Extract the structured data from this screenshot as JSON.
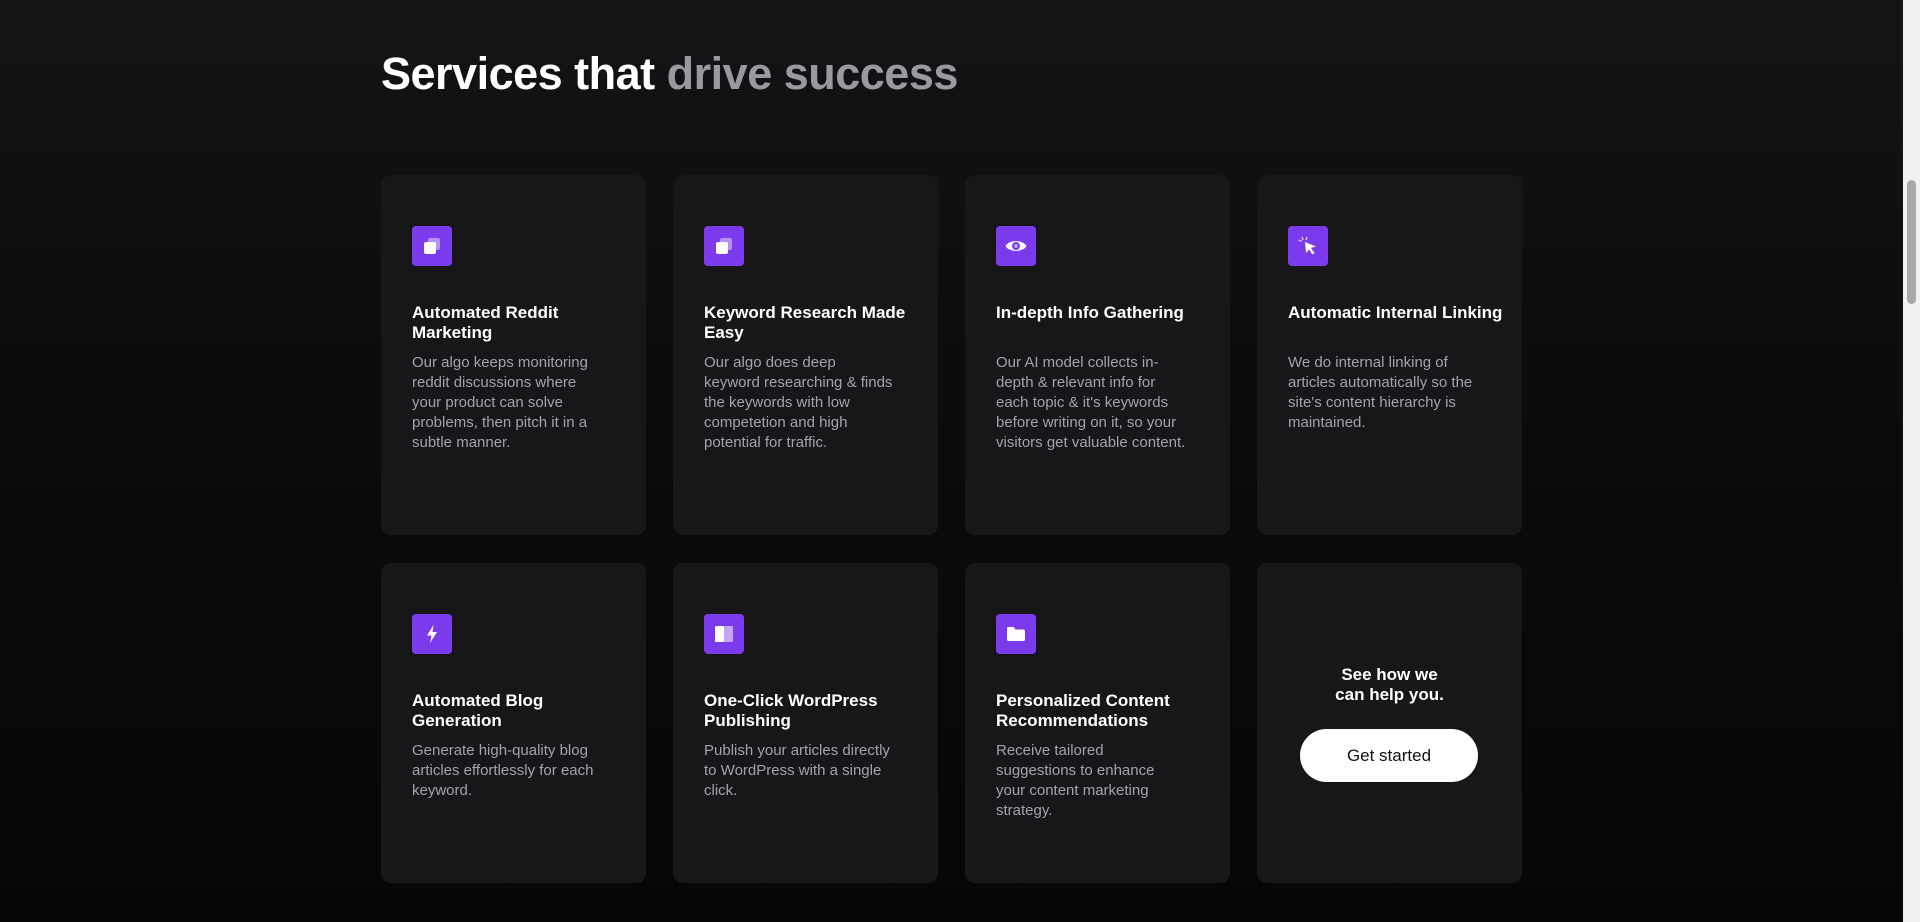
{
  "section": {
    "heading_strong": "Services that",
    "heading_muted": "drive success"
  },
  "services": [
    {
      "icon": "copy-icon",
      "title": "Automated Reddit Marketing",
      "description": "Our algo keeps monitoring reddit discussions where your product can solve problems, then pitch it in a subtle manner."
    },
    {
      "icon": "copy-icon",
      "title": "Keyword Research Made Easy",
      "description": "Our algo does deep keyword researching & finds the keywords with low competetion and high potential for traffic."
    },
    {
      "icon": "eye-icon",
      "title": "In-depth Info Gathering",
      "description": "Our AI model collects in-depth & relevant info for each topic & it's keywords before writing on it, so your visitors get valuable content."
    },
    {
      "icon": "cursor-click-icon",
      "title": "Automatic Internal Linking",
      "description": "We do internal linking of articles automatically so the site's content hierarchy is maintained."
    },
    {
      "icon": "lightning-bolt-icon",
      "title": "Automated Blog Generation",
      "description": "Generate high-quality blog articles effortlessly for each keyword."
    },
    {
      "icon": "book-open-icon",
      "title": "One-Click WordPress Publishing",
      "description": "Publish your articles directly to WordPress with a single click."
    },
    {
      "icon": "folder-icon",
      "title": "Personalized Content Recommendations",
      "description": "Receive tailored suggestions to enhance your content marketing strategy."
    }
  ],
  "cta": {
    "line1": "See how we",
    "line2": "can help you.",
    "button_label": "Get started"
  },
  "colors": {
    "accent": "#7c3aed",
    "card_bg": "#17171a",
    "page_bg": "#0c0c0e",
    "heading": "#ffffff",
    "heading_muted": "#9a9a9e",
    "body_text": "#a3a3ab"
  }
}
